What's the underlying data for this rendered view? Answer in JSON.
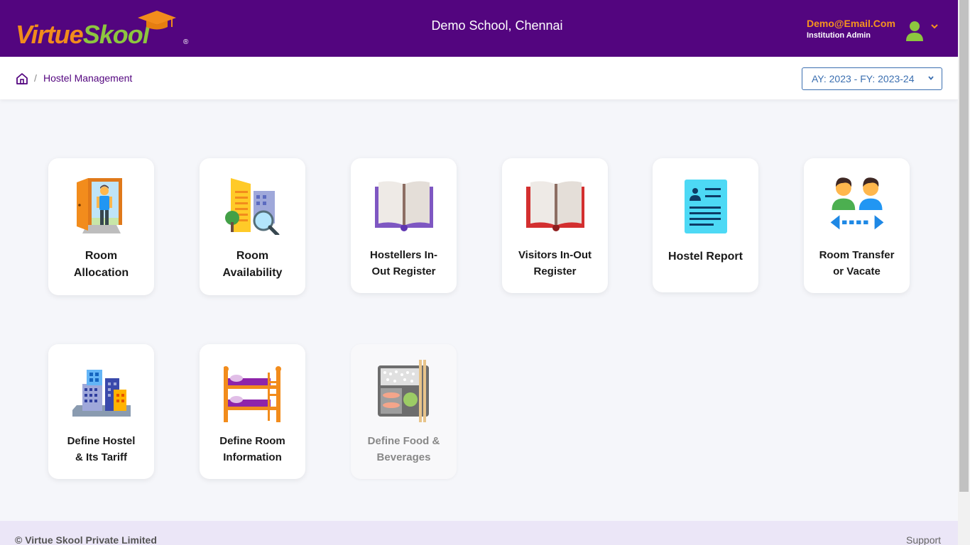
{
  "header": {
    "logo_text_1": "Virtue",
    "logo_text_2": "Skool",
    "logo_reg": "®",
    "school_name": "Demo School, Chennai",
    "user_email": "Demo@Email.Com",
    "user_role": "Institution Admin",
    "accent_purple": "#53057f",
    "accent_orange": "#f7941d",
    "accent_green": "#8dc63f"
  },
  "breadcrumb": {
    "separator": "/",
    "current": "Hostel Management"
  },
  "year_selector": {
    "value": "AY: 2023 - FY: 2023-24"
  },
  "tiles": [
    {
      "line1": "Room",
      "line2": "Allocation",
      "icon": "door-person-icon"
    },
    {
      "line1": "Room",
      "line2": "Availability",
      "icon": "building-search-icon"
    },
    {
      "line1": "Hostellers In-",
      "line2": "Out Register",
      "icon": "open-book-purple-icon"
    },
    {
      "line1": "Visitors In-Out",
      "line2": "Register",
      "icon": "open-book-red-icon"
    },
    {
      "line1": "Hostel Report",
      "line2": "",
      "icon": "id-report-icon"
    },
    {
      "line1": "Room Transfer",
      "line2": "or Vacate",
      "icon": "people-transfer-icon"
    },
    {
      "line1": "Define Hostel",
      "line2": "& Its Tariff",
      "icon": "city-buildings-icon"
    },
    {
      "line1": "Define Room",
      "line2": "Information",
      "icon": "bunk-bed-icon"
    },
    {
      "line1": "Define Food &",
      "line2": "Beverages",
      "icon": "bento-box-icon",
      "disabled": true
    }
  ],
  "footer": {
    "copyright": "© Virtue Skool Private Limited",
    "support": "Support"
  }
}
